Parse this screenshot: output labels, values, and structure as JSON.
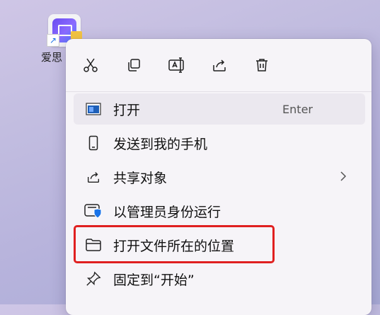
{
  "desktop": {
    "icon_label": "爱思"
  },
  "quick_actions": [
    {
      "name": "cut",
      "icon": "scissors-icon"
    },
    {
      "name": "copy",
      "icon": "copy-icon"
    },
    {
      "name": "rename",
      "icon": "rename-icon"
    },
    {
      "name": "share",
      "icon": "share-icon"
    },
    {
      "name": "delete",
      "icon": "trash-icon"
    }
  ],
  "menu": {
    "items": [
      {
        "label": "打开",
        "accelerator": "Enter",
        "icon": "app-window-icon"
      },
      {
        "label": "发送到我的手机",
        "icon": "phone-icon"
      },
      {
        "label": "共享对象",
        "icon": "share-icon",
        "has_submenu": true
      },
      {
        "label": "以管理员身份运行",
        "icon": "shield-admin-icon"
      },
      {
        "label": "打开文件所在的位置",
        "icon": "folder-icon"
      },
      {
        "label": "固定到“开始”",
        "icon": "pin-icon"
      }
    ]
  },
  "colors": {
    "highlight": "#e02020",
    "accent": "#1a73e8"
  }
}
